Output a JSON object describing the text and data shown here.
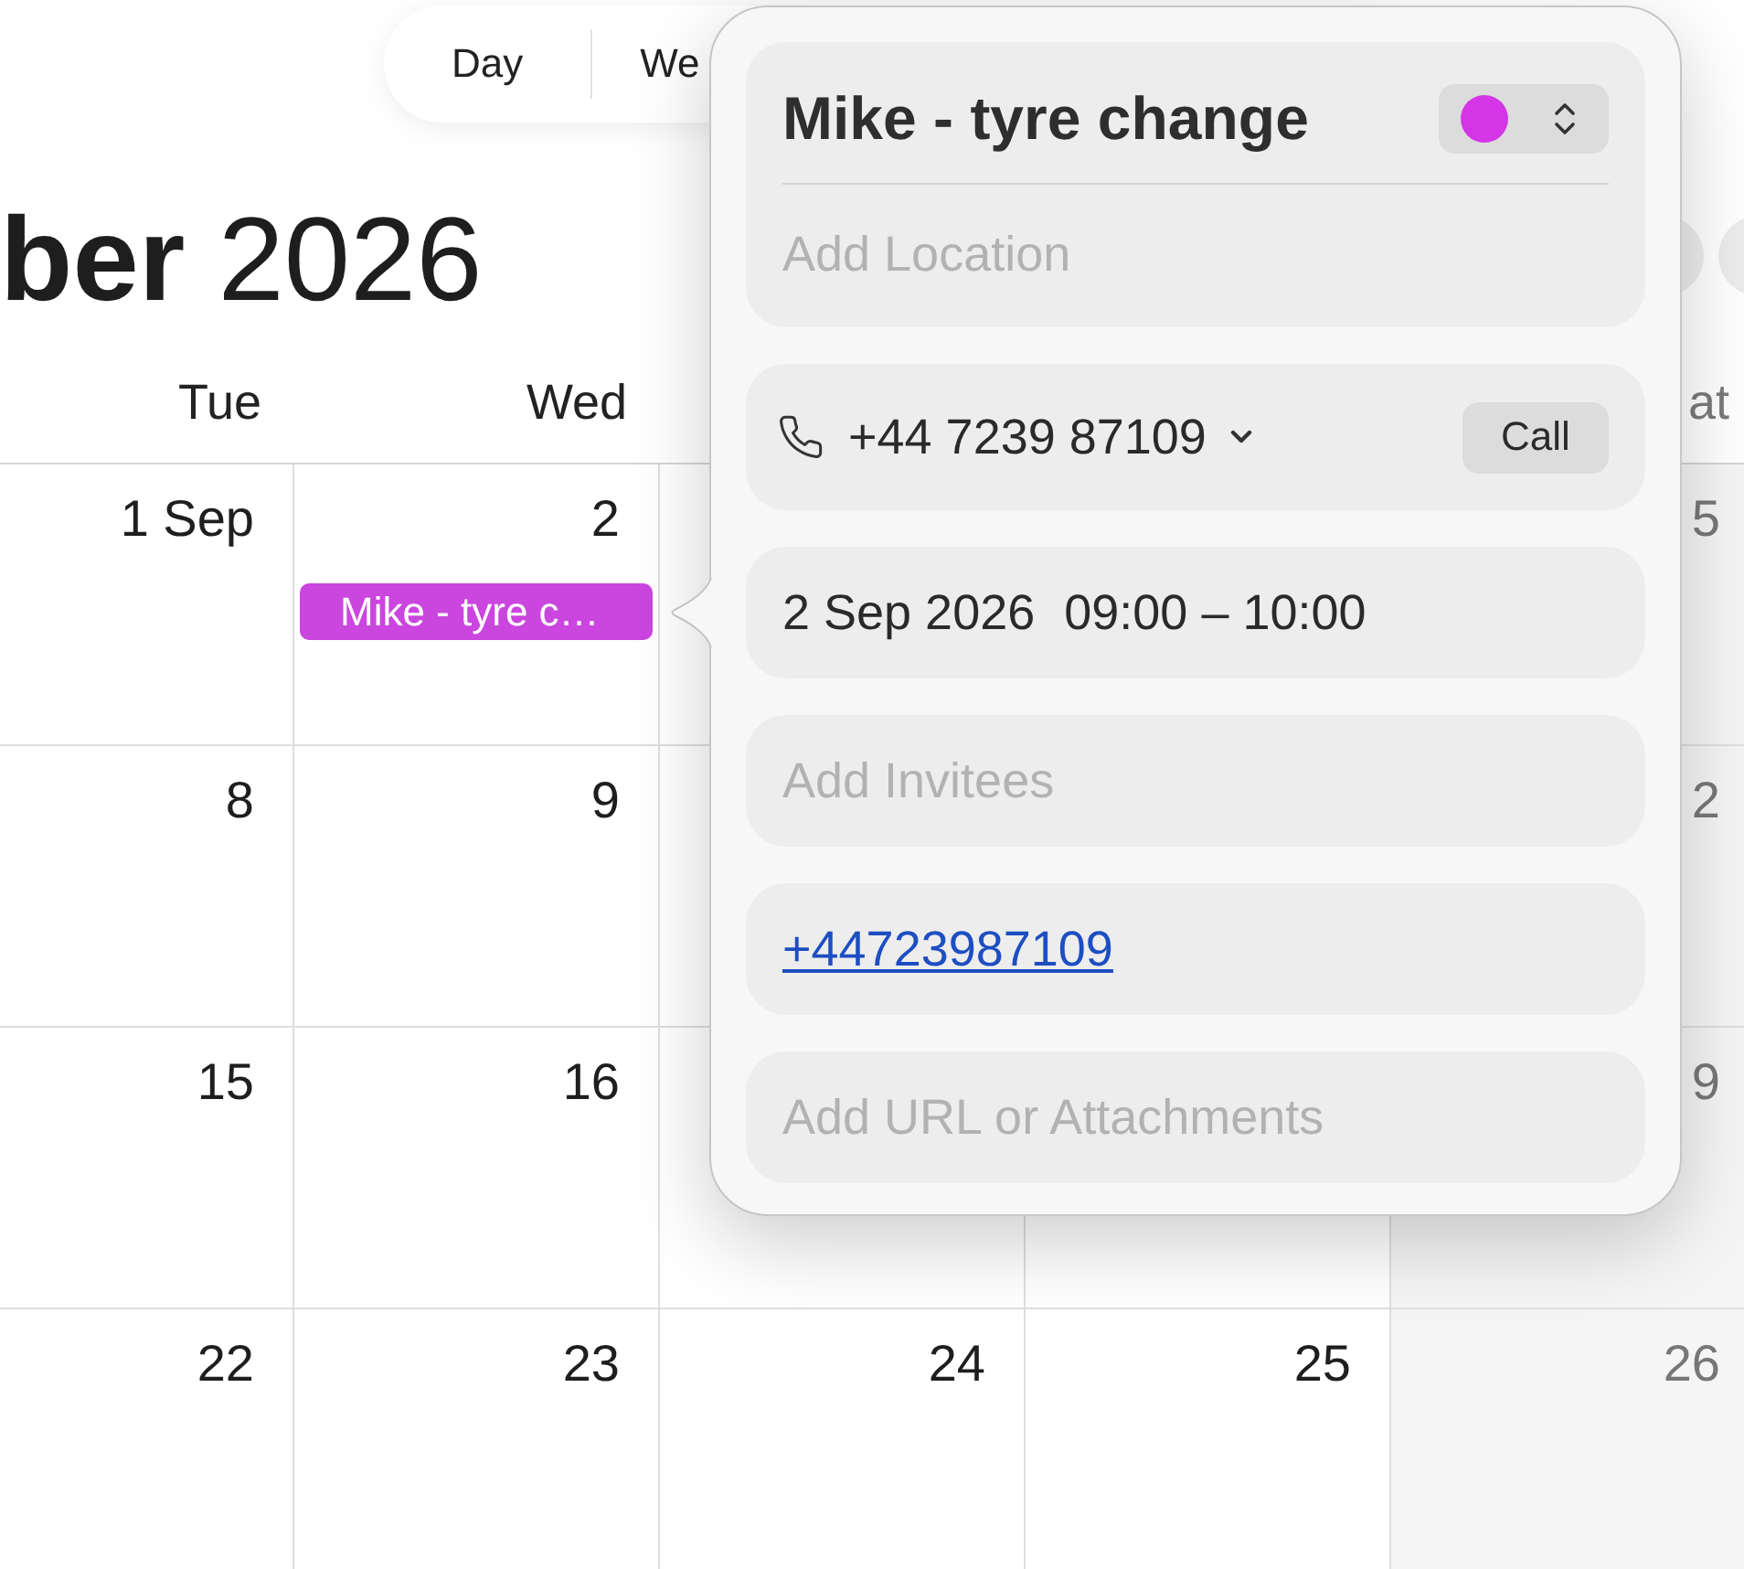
{
  "toolbar": {
    "view_tabs": [
      {
        "label": "Day",
        "selected": false
      },
      {
        "label": "We",
        "selected": false
      }
    ]
  },
  "header": {
    "title": "**ber** 2026"
  },
  "columns": [
    {
      "heading": "Tue",
      "weekend": false
    },
    {
      "heading": "Wed",
      "weekend": false
    },
    {
      "weekend": false
    },
    {
      "weekend": false
    },
    {
      "heading": "at",
      "weekend": true
    }
  ],
  "weeks": [
    {
      "column_1": {
        "label": "1 Sep"
      },
      "column_2": {
        "label": "2",
        "events": [
          {
            "title": "Mike - tyre c…",
            "color": "#cb45df",
            "selected": true
          }
        ]
      },
      "column_5": {
        "label": "5"
      }
    },
    {
      "column_1": {
        "label": "8"
      },
      "column_2": {
        "label": "9"
      },
      "column_5": {
        "label": "2"
      }
    },
    {
      "column_1": {
        "label": "15"
      },
      "column_2": {
        "label": "16"
      },
      "column_5": {
        "label": "9"
      }
    },
    {
      "column_1": {
        "label": "22"
      },
      "column_2": {
        "label": "23"
      },
      "column_3": {
        "label": "24"
      },
      "column_4": {
        "label": "25"
      },
      "column_5": {
        "label": "26"
      }
    }
  ],
  "popover": {
    "title": "Mike - tyre change",
    "color": "#d435e6",
    "location": {
      "placeholder": "Add Location"
    },
    "phone": {
      "number": "+44 7239 87109",
      "button": "Call"
    },
    "date": "2 Sep 2026",
    "time": "09:00 – 10:00",
    "invitees": {
      "placeholder": "Add Invitees"
    },
    "notes": {
      "link": "+44723987109"
    },
    "attachments": {
      "placeholder": "Add URL or Attachments"
    }
  }
}
